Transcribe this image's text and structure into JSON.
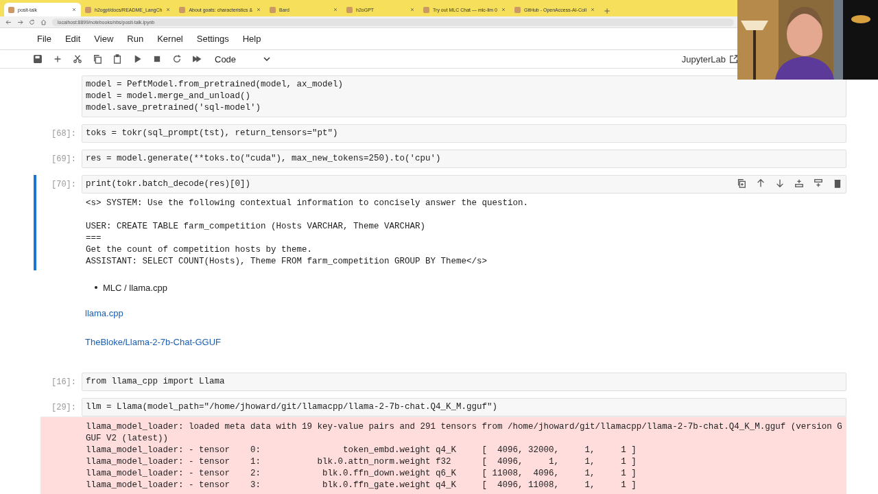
{
  "browser": {
    "tabs": [
      {
        "title": "posit-talk",
        "selected": true
      },
      {
        "title": "h2ogpt/docs/README_LangCh",
        "selected": false
      },
      {
        "title": "About goats: characteristics &",
        "selected": false
      },
      {
        "title": "Bard",
        "selected": false
      },
      {
        "title": "h2oGPT",
        "selected": false
      },
      {
        "title": "Try out MLC Chat — mlc-llm 0",
        "selected": false
      },
      {
        "title": "GitHub - OpenAccess-AI-Coll",
        "selected": false
      }
    ],
    "address": "localhost:8899/notebooks/nbs/posit-talk.ipynb"
  },
  "menu": [
    "File",
    "Edit",
    "View",
    "Run",
    "Kernel",
    "Settings",
    "Help"
  ],
  "toolbar": {
    "cell_type": "Code",
    "app_link": "JupyterLab"
  },
  "cells": [
    {
      "kind": "code",
      "active": false,
      "lines": [
        "model = PeftModel.from_pretrained(model, ax_model)",
        "model = model.merge_and_unload()",
        "model.save_pretrained('sql-model')"
      ]
    },
    {
      "kind": "code",
      "prompt": "[68]:",
      "active": false,
      "lines": [
        "toks = tokr(sql_prompt(tst), return_tensors=\"pt\")"
      ]
    },
    {
      "kind": "code",
      "prompt": "[69]:",
      "active": false,
      "lines": [
        "res = model.generate(**toks.to(\"cuda\"), max_new_tokens=250).to('cpu')"
      ]
    },
    {
      "kind": "code",
      "prompt": "[70]:",
      "active": true,
      "lines": [
        "print(tokr.batch_decode(res)[0])"
      ],
      "output": {
        "error": false,
        "lines": [
          "<s> SYSTEM: Use the following contextual information to concisely answer the question."
        ],
        "more_lines": [
          "USER: CREATE TABLE farm_competition (Hosts VARCHAR, Theme VARCHAR)",
          "===",
          "Get the count of competition hosts by theme.",
          "ASSISTANT: SELECT COUNT(Hosts), Theme FROM farm_competition GROUP BY Theme</s>"
        ]
      }
    },
    {
      "kind": "markdown",
      "blocks": [
        {
          "kind": "bullet",
          "text": "MLC / llama.cpp"
        },
        {
          "kind": "link",
          "text": "llama.cpp"
        },
        {
          "kind": "link",
          "text": "TheBloke/Llama-2-7b-Chat-GGUF"
        }
      ]
    },
    {
      "kind": "code",
      "prompt": "[16]:",
      "active": false,
      "lines": [
        "from llama_cpp import Llama"
      ]
    },
    {
      "kind": "code",
      "prompt": "[29]:",
      "active": false,
      "lines": [
        "llm = Llama(model_path=\"/home/jhoward/git/llamacpp/llama-2-7b-chat.Q4_K_M.gguf\")"
      ],
      "output": {
        "error": true,
        "lines": [
          "llama_model_loader: loaded meta data with 19 key-value pairs and 291 tensors from /home/jhoward/git/llamacpp/llama-2-7b-chat.Q4_K_M.gguf (version GGUF V2 (latest))",
          "llama_model_loader: - tensor    0:                token_embd.weight q4_K     [  4096, 32000,     1,     1 ]",
          "llama_model_loader: - tensor    1:           blk.0.attn_norm.weight f32      [  4096,     1,     1,     1 ]",
          "llama_model_loader: - tensor    2:            blk.0.ffn_down.weight q6_K     [ 11008,  4096,     1,     1 ]",
          "llama_model_loader: - tensor    3:            blk.0.ffn_gate.weight q4_K     [  4096, 11008,     1,     1 ]"
        ]
      }
    }
  ]
}
